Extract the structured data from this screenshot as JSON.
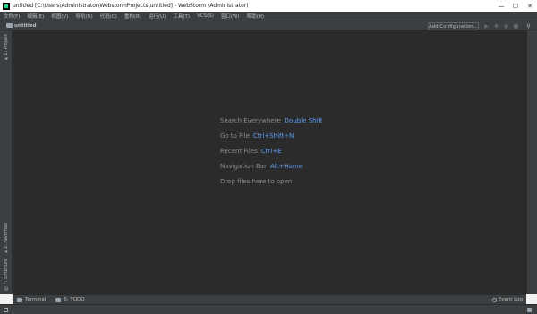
{
  "window": {
    "title": "untitled [C:\\Users\\Administrator\\WebstormProjects\\untitled] - WebStorm (Administrator)",
    "controls": {
      "minimize": "—",
      "maximize": "☐",
      "close": "✕"
    }
  },
  "menu": {
    "items": [
      "文件(F)",
      "编辑(E)",
      "视图(V)",
      "导航(N)",
      "代码(C)",
      "重构(R)",
      "运行(U)",
      "工具(T)",
      "VCS(S)",
      "窗口(W)",
      "帮助(H)"
    ]
  },
  "navbar": {
    "project_name": "untitled",
    "add_configuration": "Add Configuration...",
    "icons": [
      "run-icon",
      "debug-icon",
      "coverage-icon",
      "stop-icon",
      "search-icon"
    ]
  },
  "left_stripe": {
    "project": "1: Project",
    "favorites": "2: Favorites",
    "structure": "7: Structure"
  },
  "editor": {
    "hints": [
      {
        "label": "Search Everywhere",
        "shortcut": "Double Shift"
      },
      {
        "label": "Go to File",
        "shortcut": "Ctrl+Shift+N"
      },
      {
        "label": "Recent Files",
        "shortcut": "Ctrl+E"
      },
      {
        "label": "Navigation Bar",
        "shortcut": "Alt+Home"
      },
      {
        "label": "Drop files here to open",
        "shortcut": ""
      }
    ]
  },
  "bottombar": {
    "terminal": "Terminal",
    "todo": "6: TODO",
    "event_log": "Event Log"
  },
  "colors": {
    "editor_bg": "#2b2b2b",
    "panel_bg": "#3c3f41",
    "shortcut": "#589df6",
    "hint_text": "#8c8c8c"
  }
}
